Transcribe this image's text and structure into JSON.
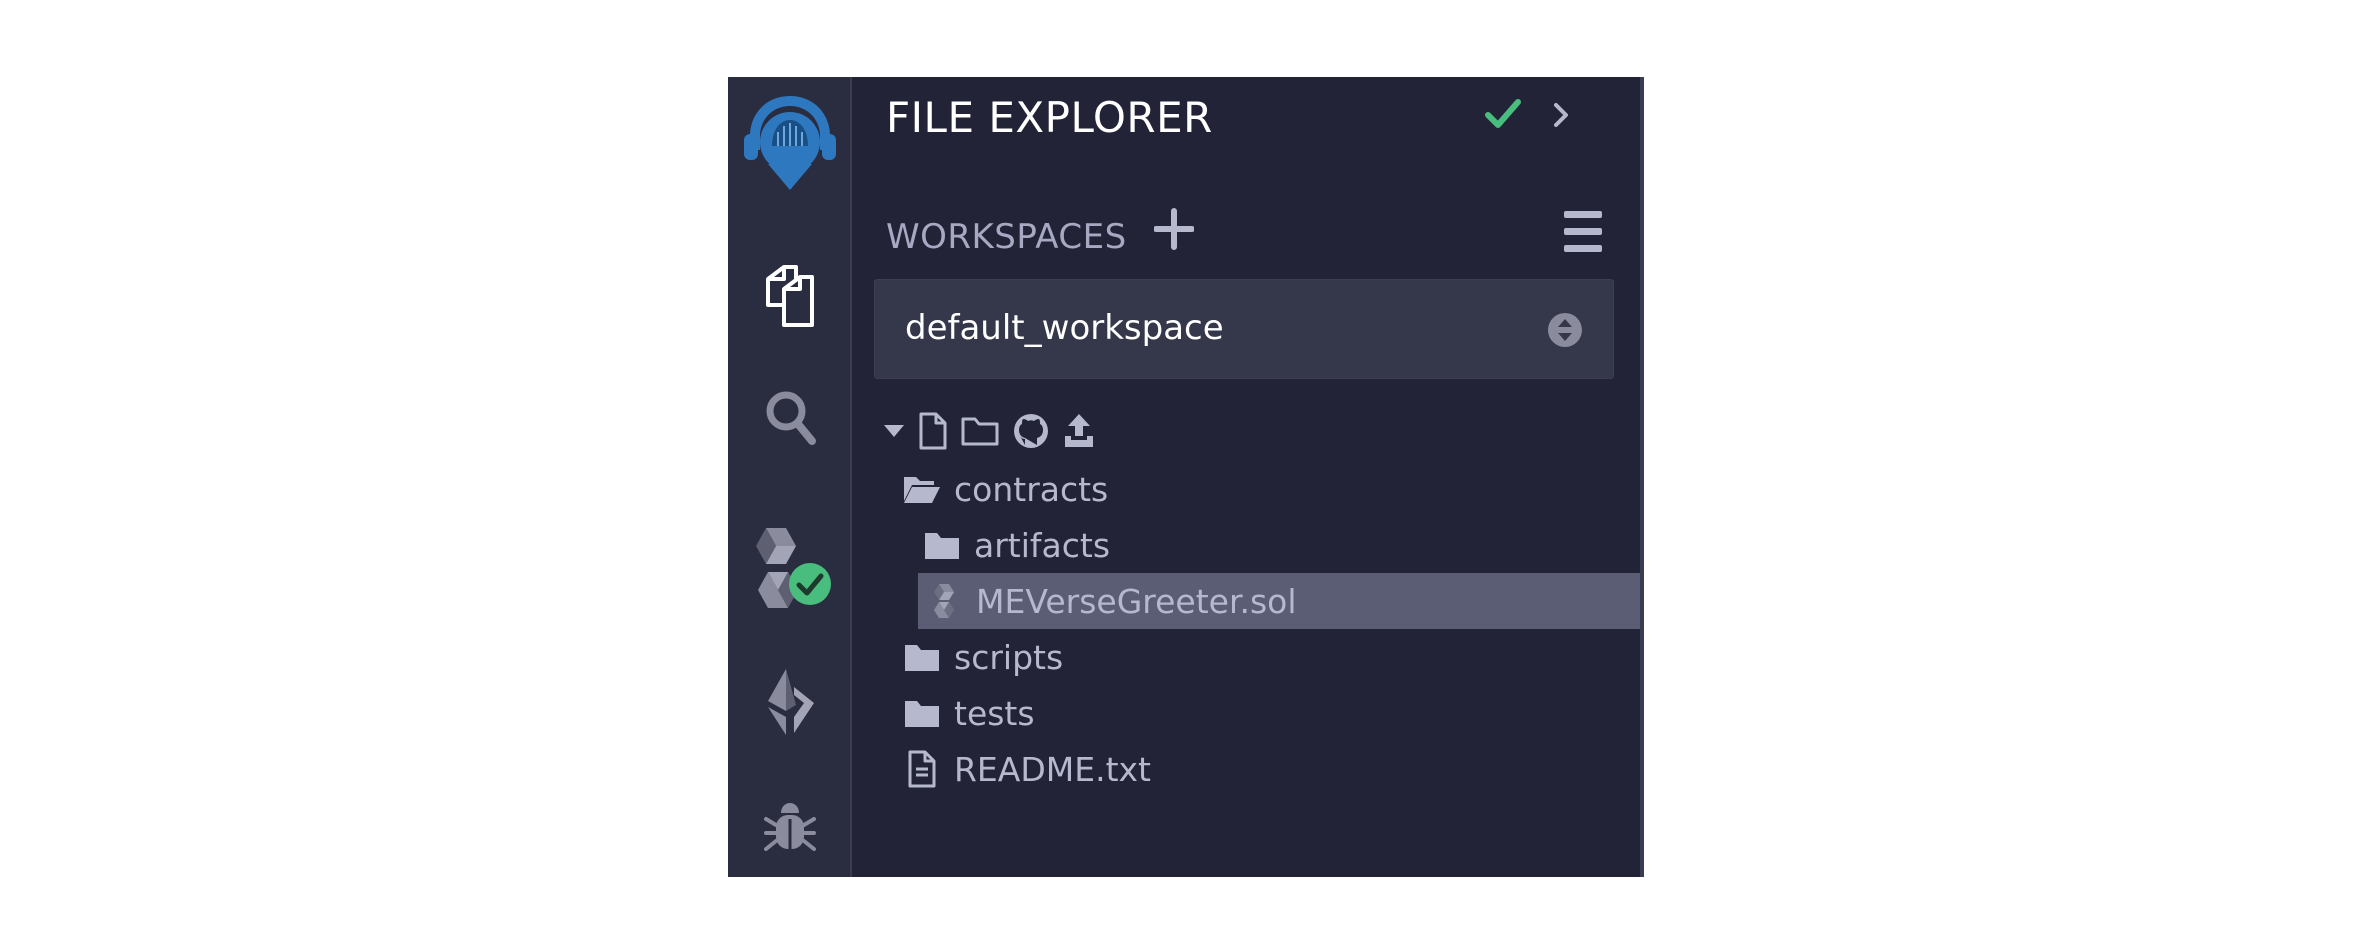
{
  "panel": {
    "title": "FILE EXPLORER"
  },
  "workspaces": {
    "label": "WORKSPACES",
    "selected": "default_workspace"
  },
  "tree": {
    "items": [
      {
        "label": "contracts"
      },
      {
        "label": "artifacts"
      },
      {
        "label": "MEVerseGreeter.sol"
      },
      {
        "label": "scripts"
      },
      {
        "label": "tests"
      },
      {
        "label": "README.txt"
      }
    ]
  },
  "icons": {
    "logo": "remix-logo-icon",
    "files": "file-explorer-icon",
    "search": "search-icon",
    "compiler": "solidity-compiler-icon",
    "compiler_badge": "check-badge-icon",
    "deploy": "ethereum-deploy-icon",
    "debug": "bug-icon",
    "status_check": "check-icon",
    "chevron": "chevron-right-icon",
    "add": "plus-icon",
    "menu": "hamburger-menu-icon"
  },
  "colors": {
    "panel_bg": "#222336",
    "iconbar_bg": "#2a2c3f",
    "accent_blue": "#2e78c0",
    "success_green": "#48bd7d",
    "selected_row": "#5b5d75"
  }
}
